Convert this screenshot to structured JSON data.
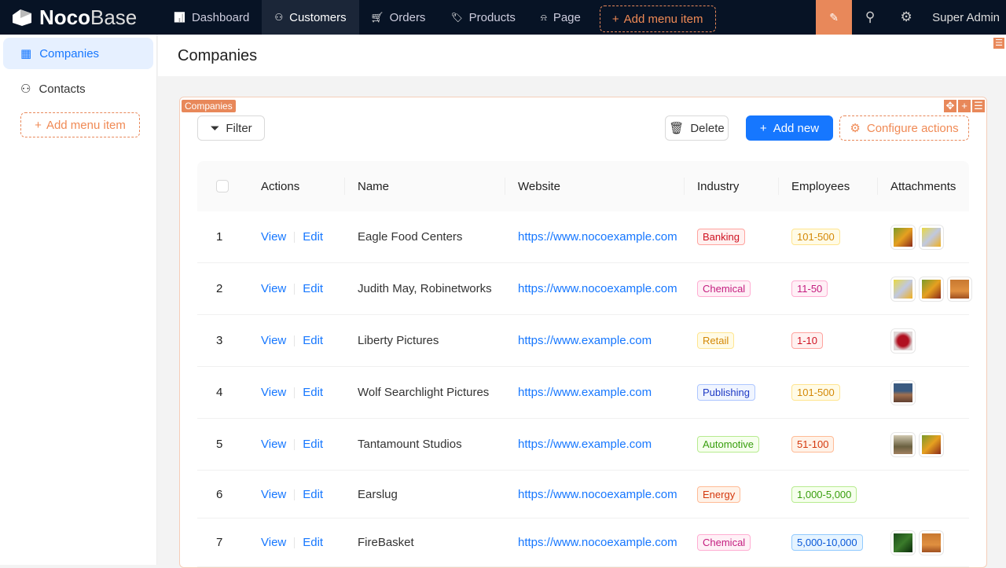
{
  "brand": {
    "bold": "Noco",
    "light": "Base"
  },
  "nav": [
    {
      "label": "Dashboard",
      "icon": "bar-chart-icon"
    },
    {
      "label": "Customers",
      "icon": "team-icon",
      "active": true
    },
    {
      "label": "Orders",
      "icon": "cart-icon"
    },
    {
      "label": "Products",
      "icon": "tag-icon"
    },
    {
      "label": "Page",
      "icon": "alert-icon"
    }
  ],
  "nav_add": "Add menu item",
  "user": "Super Admin",
  "sidebar": {
    "items": [
      {
        "label": "Companies",
        "active": true
      },
      {
        "label": "Contacts"
      }
    ],
    "add": "Add menu item"
  },
  "page": {
    "title": "Companies"
  },
  "block": {
    "tag": "Companies",
    "filter": "Filter",
    "delete": "Delete",
    "add_new": "Add new",
    "configure": "Configure actions"
  },
  "table": {
    "columns": [
      "Actions",
      "Name",
      "Website",
      "Industry",
      "Employees",
      "Attachments"
    ],
    "view": "View",
    "edit": "Edit",
    "rows": [
      {
        "no": "1",
        "name": "Eagle Food Centers",
        "website": "https://www.nocoexample.com",
        "industry": "Banking",
        "industry_color": "red",
        "employees": "101-500",
        "employees_color": "gold",
        "attachments": [
          "fruit",
          "citrus"
        ]
      },
      {
        "no": "2",
        "name": "Judith May, Robinetworks",
        "website": "https://www.nocoexample.com",
        "industry": "Chemical",
        "industry_color": "magenta",
        "employees": "11-50",
        "employees_color": "magenta",
        "attachments": [
          "citrus",
          "fruit",
          "desert"
        ]
      },
      {
        "no": "3",
        "name": "Liberty Pictures",
        "website": "https://www.example.com",
        "industry": "Retail",
        "industry_color": "gold",
        "employees": "1-10",
        "employees_color": "red",
        "attachments": [
          "berries"
        ]
      },
      {
        "no": "4",
        "name": "Wolf Searchlight Pictures",
        "website": "https://www.example.com",
        "industry": "Publishing",
        "industry_color": "geekblue",
        "employees": "101-500",
        "employees_color": "gold",
        "attachments": [
          "landscape"
        ]
      },
      {
        "no": "5",
        "name": "Tantamount Studios",
        "website": "https://www.example.com",
        "industry": "Automotive",
        "industry_color": "green",
        "employees": "51-100",
        "employees_color": "volcano",
        "attachments": [
          "tree",
          "fruit"
        ]
      },
      {
        "no": "6",
        "name": "Earslug",
        "website": "https://www.nocoexample.com",
        "industry": "Energy",
        "industry_color": "volcano",
        "employees": "1,000-5,000",
        "employees_color": "green",
        "attachments": []
      },
      {
        "no": "7",
        "name": "FireBasket",
        "website": "https://www.nocoexample.com",
        "industry": "Chemical",
        "industry_color": "magenta",
        "employees": "5,000-10,000",
        "employees_color": "blue",
        "attachments": [
          "leaves",
          "desert"
        ]
      }
    ]
  },
  "colors": {
    "accent": "#1677ff",
    "design": "#e8885a",
    "header": "#071325"
  }
}
